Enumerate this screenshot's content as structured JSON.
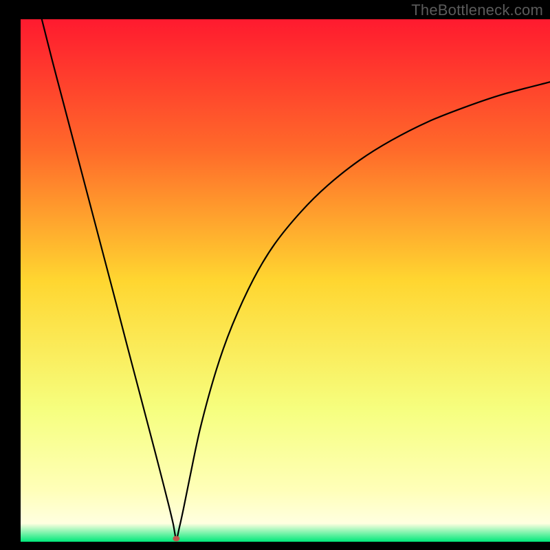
{
  "watermark": "TheBottleneck.com",
  "chart_data": {
    "type": "line",
    "title": "",
    "xlabel": "",
    "ylabel": "",
    "xlim": [
      0,
      100
    ],
    "ylim": [
      0,
      100
    ],
    "grid": false,
    "legend_position": "none",
    "gradient_stops": [
      {
        "offset": 0.0,
        "color": "#ff1a2f"
      },
      {
        "offset": 0.25,
        "color": "#ff6a2a"
      },
      {
        "offset": 0.5,
        "color": "#ffd630"
      },
      {
        "offset": 0.75,
        "color": "#f6ff80"
      },
      {
        "offset": 0.9,
        "color": "#ffffb8"
      },
      {
        "offset": 0.965,
        "color": "#ffffe0"
      },
      {
        "offset": 1.0,
        "color": "#00e87a"
      }
    ],
    "minimum_marker": {
      "x": 29.4,
      "y": 0.6,
      "color": "#c0554c",
      "rx": 5,
      "ry": 4
    },
    "series": [
      {
        "name": "bottleneck-curve",
        "x": [
          4.0,
          6.0,
          8.0,
          10.0,
          12.0,
          14.0,
          16.0,
          18.0,
          20.0,
          22.0,
          24.0,
          25.5,
          27.0,
          28.0,
          28.8,
          29.4,
          30.0,
          30.8,
          32.0,
          34.0,
          37.0,
          40.0,
          44.0,
          48.0,
          53.0,
          58.0,
          64.0,
          70.0,
          77.0,
          84.0,
          91.0,
          100.0
        ],
        "y": [
          100.0,
          92.0,
          84.3,
          76.6,
          68.9,
          61.2,
          53.5,
          45.8,
          38.0,
          30.3,
          22.6,
          16.8,
          10.9,
          6.9,
          3.5,
          0.6,
          2.8,
          6.5,
          12.5,
          22.0,
          33.0,
          41.5,
          50.3,
          57.0,
          63.2,
          68.2,
          73.0,
          76.8,
          80.4,
          83.2,
          85.6,
          88.0
        ]
      }
    ]
  }
}
